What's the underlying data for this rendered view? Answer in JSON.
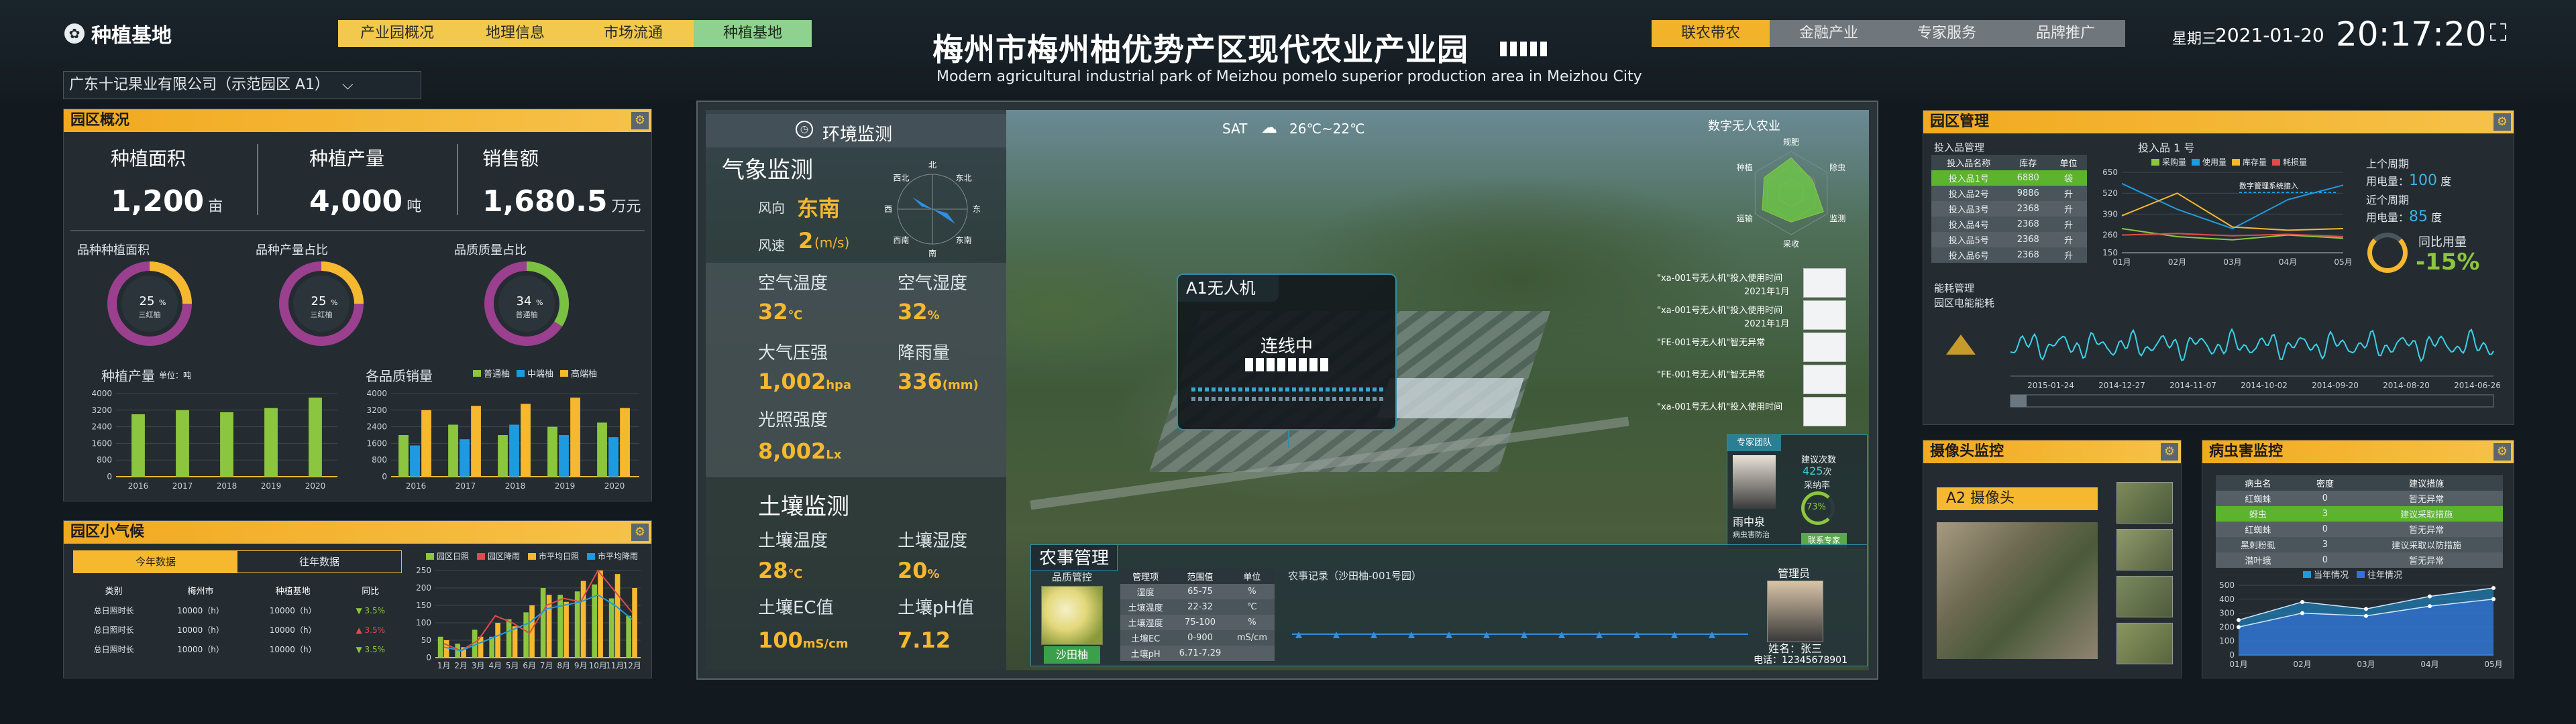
{
  "header": {
    "logo_text": "种植基地",
    "left_tabs": [
      {
        "label": "产业园概况"
      },
      {
        "label": "地理信息"
      },
      {
        "label": "市场流通"
      },
      {
        "label": "种植基地"
      }
    ],
    "title": "梅州市梅州柚优势产区现代农业产业园",
    "subtitle": "Modern agricultural industrial park of Meizhou pomelo superior production area in Meizhou City",
    "right_tabs": [
      {
        "label": "联农带农"
      },
      {
        "label": "金融产业"
      },
      {
        "label": "专家服务"
      },
      {
        "label": "品牌推广"
      }
    ],
    "weekday": "星期三",
    "date": "2021-01-20",
    "time": "20:17:20"
  },
  "company_select": {
    "value": "广东十记果业有限公司（示范园区 A1）"
  },
  "overview": {
    "title": "园区概况",
    "stats": [
      {
        "label": "种植面积",
        "value": "1,200",
        "unit": "亩"
      },
      {
        "label": "种植产量",
        "value": "4,000",
        "unit": "吨"
      },
      {
        "label": "销售额",
        "value": "1,680.5",
        "unit": "万元"
      }
    ],
    "donuts": [
      {
        "label": "品种种植面积",
        "pct": "25",
        "name": "三红柚",
        "fraction": 0.25,
        "color": "#f5b82e"
      },
      {
        "label": "品种产量占比",
        "pct": "25",
        "name": "三红柚",
        "fraction": 0.25,
        "color": "#f5b82e"
      },
      {
        "label": "品质质量占比",
        "pct": "34",
        "name": "普通柚",
        "fraction": 0.34,
        "color": "#7ac142"
      }
    ],
    "chart1": {
      "title": "种植产量",
      "unit": "单位：吨"
    },
    "chart2": {
      "title": "各品质销量"
    },
    "legend2": [
      {
        "name": "普通柚",
        "color": "#8cc63f"
      },
      {
        "name": "中端柚",
        "color": "#1e9be0"
      },
      {
        "name": "高端柚",
        "color": "#f5b82e"
      }
    ]
  },
  "climate": {
    "title": "园区小气候",
    "tabs": [
      {
        "label": "今年数据"
      },
      {
        "label": "往年数据"
      }
    ],
    "headers": [
      "类别",
      "梅州市",
      "种植基地",
      "同比"
    ],
    "rows": [
      {
        "c1": "总日照时长",
        "c2": "10000（h）",
        "c3": "10000（h）",
        "c4": "3.5%",
        "dir": "up"
      },
      {
        "c1": "总日照时长",
        "c2": "10000（h）",
        "c3": "10000（h）",
        "c4": "3.5%",
        "dir": "down"
      },
      {
        "c1": "总日照时长",
        "c2": "10000（h）",
        "c3": "10000（h）",
        "c4": "3.5%",
        "dir": "up"
      }
    ],
    "legend": [
      {
        "name": "园区日照",
        "color": "#8cc63f"
      },
      {
        "name": "园区降雨",
        "color": "#e04b4b"
      },
      {
        "name": "市平均日照",
        "color": "#f5b82e"
      },
      {
        "name": "市平均降雨",
        "color": "#1e9be0"
      }
    ],
    "months": [
      "1月",
      "2月",
      "3月",
      "4月",
      "5月",
      "6月",
      "7月",
      "8月",
      "9月",
      "10月",
      "11月",
      "12月"
    ]
  },
  "env": {
    "title": "环境监测",
    "weather_title": "气象监测",
    "wind_dir_label": "风向",
    "wind_dir": "东南",
    "wind_speed_label": "风速",
    "wind_speed": "2",
    "wind_speed_unit": "(m/s)",
    "compass": [
      "北",
      "东北",
      "东",
      "东南",
      "南",
      "西南",
      "西",
      "西北"
    ],
    "metrics": [
      {
        "label": "空气温度",
        "value": "32",
        "unit": "℃"
      },
      {
        "label": "空气湿度",
        "value": "32",
        "unit": "%"
      },
      {
        "label": "大气压强",
        "value": "1,002",
        "unit": "hpa"
      },
      {
        "label": "降雨量",
        "value": "336",
        "unit": "(mm)"
      },
      {
        "label": "光照强度",
        "value": "8,002",
        "unit": "Lx"
      }
    ],
    "soil_title": "土壤监测",
    "soil": [
      {
        "label": "土壤温度",
        "value": "28",
        "unit": "℃"
      },
      {
        "label": "土壤湿度",
        "value": "20",
        "unit": "%"
      },
      {
        "label": "土壤EC值",
        "value": "100",
        "unit": "mS/cm"
      },
      {
        "label": "土壤pH值",
        "value": "7.12",
        "unit": ""
      }
    ]
  },
  "map": {
    "weather_day": "SAT",
    "weather_temp": "26℃~22℃",
    "drone_title": "A1无人机",
    "drone_status": "连线中",
    "radar_title": "数字无人农业",
    "radar_axes": [
      "规肥",
      "除虫",
      "监测",
      "采收",
      "运输",
      "种植"
    ],
    "drone_logs": [
      {
        "text": "\"xa-001号无人机\"投入使用时间",
        "date": "2021年1月"
      },
      {
        "text": "\"xa-001号无人机\"投入使用时间",
        "date": "2021年1月"
      },
      {
        "text": "\"FE-001号无人机\"智无异常",
        "date": ""
      },
      {
        "text": "\"FE-001号无人机\"智无异常",
        "date": ""
      },
      {
        "text": "\"xa-001号无人机\"投入使用时间",
        "date": ""
      }
    ],
    "expert_title": "专家团队",
    "expert_name": "雨中泉",
    "expert_role": "病虫害防治",
    "expert_suggest": "建议次数",
    "expert_count": "425",
    "expert_count_unit": "次",
    "expert_adopt": "采纳率",
    "expert_adopt_pct": "73%",
    "expert_button": "联系专家"
  },
  "farm": {
    "title": "农事管理",
    "product_label": "品质管控",
    "product_name": "沙田柚",
    "table_headers": [
      "管理项",
      "范围值",
      "单位"
    ],
    "table_rows": [
      [
        "湿度",
        "65-75",
        "%"
      ],
      [
        "土壤温度",
        "22-32",
        "℃"
      ],
      [
        "土壤湿度",
        "75-100",
        "%"
      ],
      [
        "土壤EC",
        "0-900",
        "mS/cm"
      ],
      [
        "土壤pH",
        "6.71-7.29",
        ""
      ]
    ],
    "record_label": "农事记录（沙田柚-001号园）",
    "manager_title": "管理员",
    "manager_name_label": "姓名：张三",
    "manager_phone": "电话：12345678901"
  },
  "mgmt": {
    "title": "园区管理",
    "input_title": "投入品管理",
    "input_headers": [
      "投入品名称",
      "库存",
      "单位"
    ],
    "input_rows": [
      [
        "投入品1号",
        "6880",
        "袋"
      ],
      [
        "投入品2号",
        "9886",
        "升"
      ],
      [
        "投入品3号",
        "2368",
        "升"
      ],
      [
        "投入品4号",
        "2368",
        "升"
      ],
      [
        "投入品5号",
        "2368",
        "升"
      ],
      [
        "投入品6号",
        "2368",
        "升"
      ]
    ],
    "input_chart_title": "投入品 1 号",
    "input_legend": [
      {
        "name": "采购量",
        "color": "#8cc63f"
      },
      {
        "name": "使用量",
        "color": "#1e9be0"
      },
      {
        "name": "库存量",
        "color": "#f5b82e"
      },
      {
        "name": "耗损量",
        "color": "#e04b4b"
      }
    ],
    "input_chart_note": "数字管理系统接入",
    "power_last_label": "上个周期",
    "power_use_label": "用电量：",
    "power_last": "100",
    "power_unit": "度",
    "power_recent_label": "近个周期",
    "power_recent": "85",
    "power_yoy_label": "同比用量",
    "power_yoy": "-15%",
    "energy_title": "能耗管理",
    "energy_sub": "园区电能能耗",
    "energy_dates": [
      "2015-01-24",
      "2014-12-27",
      "2014-11-07",
      "2014-10-02",
      "2014-09-20",
      "2014-08-20",
      "2014-06-26"
    ]
  },
  "camera": {
    "title": "摄像头监控",
    "cam_label": "A2 摄像头"
  },
  "pest": {
    "title": "病虫害监控",
    "headers": [
      "病虫名",
      "密度",
      "建议措施"
    ],
    "rows": [
      [
        "红蜘蛛",
        "0",
        "暂无异常"
      ],
      [
        "蚜虫",
        "3",
        "建议采取措施"
      ],
      [
        "红蜘蛛",
        "0",
        "暂无异常"
      ],
      [
        "黑刺粉虱",
        "3",
        "建议采取以防措施"
      ],
      [
        "潜叶蛾",
        "0",
        "暂无异常"
      ]
    ],
    "legend": [
      {
        "name": "当年情况",
        "color": "#1e9be0"
      },
      {
        "name": "往年情况",
        "color": "#3a6ee0"
      }
    ]
  },
  "chart_data": [
    {
      "type": "bar",
      "title": "种植产量",
      "ylabel": "单位：吨",
      "categories": [
        "2016",
        "2017",
        "2018",
        "2019",
        "2020"
      ],
      "values": [
        3000,
        3200,
        3100,
        3300,
        3800
      ],
      "ylim": [
        0,
        4000
      ],
      "yticks": [
        0,
        800,
        1600,
        2400,
        3200,
        4000
      ]
    },
    {
      "type": "bar",
      "title": "各品质销量",
      "categories": [
        "2016",
        "2017",
        "2018",
        "2019",
        "2020"
      ],
      "series": [
        {
          "name": "普通柚",
          "values": [
            2000,
            2500,
            2000,
            2400,
            2600
          ]
        },
        {
          "name": "中端柚",
          "values": [
            1500,
            1800,
            2500,
            2000,
            1900
          ]
        },
        {
          "name": "高端柚",
          "values": [
            3200,
            3400,
            3500,
            3800,
            3300
          ]
        }
      ],
      "ylim": [
        0,
        4000
      ],
      "yticks": [
        0,
        800,
        1600,
        2400,
        3200,
        4000
      ]
    },
    {
      "type": "bar",
      "title": "园区小气候",
      "categories": [
        "1月",
        "2月",
        "3月",
        "4月",
        "5月",
        "6月",
        "7月",
        "8月",
        "9月",
        "10月",
        "11月",
        "12月"
      ],
      "series": [
        {
          "name": "园区日照",
          "values": [
            60,
            40,
            80,
            60,
            110,
            130,
            200,
            180,
            190,
            210,
            170,
            120
          ]
        },
        {
          "name": "园区降雨",
          "values": [
            40,
            20,
            50,
            120,
            100,
            70,
            150,
            170,
            160,
            250,
            190,
            130
          ]
        },
        {
          "name": "市平均日照",
          "values": [
            50,
            30,
            60,
            100,
            90,
            150,
            180,
            160,
            220,
            250,
            240,
            200
          ]
        },
        {
          "name": "市平均降雨",
          "values": [
            30,
            20,
            40,
            60,
            80,
            100,
            140,
            150,
            160,
            180,
            150,
            110
          ]
        }
      ],
      "ylim": [
        0,
        250
      ],
      "yticks": [
        0,
        50,
        100,
        150,
        200,
        250
      ]
    },
    {
      "type": "line",
      "title": "投入品 1 号",
      "categories": [
        "01月",
        "02月",
        "03月",
        "04月",
        "05月"
      ],
      "series": [
        {
          "name": "采购量",
          "values": [
            300,
            250,
            230,
            260,
            240
          ]
        },
        {
          "name": "使用量",
          "values": [
            580,
            420,
            300,
            480,
            570
          ]
        },
        {
          "name": "库存量",
          "values": [
            380,
            520,
            310,
            290,
            300
          ]
        },
        {
          "name": "耗损量",
          "values": [
            260,
            270,
            255,
            265,
            250
          ]
        }
      ],
      "ylim": [
        150,
        650
      ],
      "yticks": [
        150,
        260,
        390,
        520,
        650
      ]
    },
    {
      "type": "area",
      "title": "病虫害监控",
      "categories": [
        "01月",
        "02月",
        "03月",
        "04月",
        "05月"
      ],
      "series": [
        {
          "name": "当年情况",
          "values": [
            250,
            380,
            330,
            420,
            480
          ]
        },
        {
          "name": "往年情况",
          "values": [
            200,
            300,
            280,
            350,
            400
          ]
        }
      ],
      "ylim": [
        0,
        500
      ],
      "yticks": [
        0,
        100,
        200,
        300,
        400,
        500
      ]
    }
  ]
}
